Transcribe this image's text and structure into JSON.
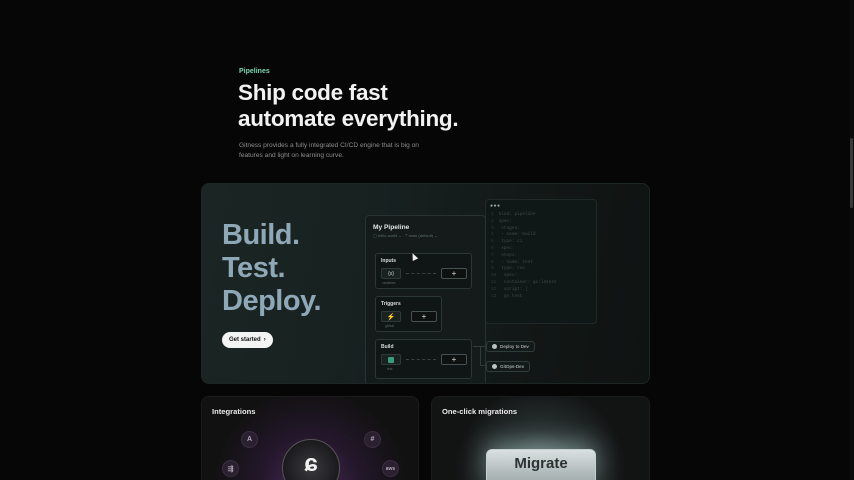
{
  "section": {
    "eyebrow": "Pipelines",
    "headline_line1": "Ship code fast",
    "headline_line2": "automate everything.",
    "subtitle": "Gitness provides a fully integrated CI/CD engine that is big on features and light on learning curve."
  },
  "hero": {
    "words": [
      "Build.",
      "Test.",
      "Deploy."
    ],
    "cta_label": "Get started",
    "cta_icon": "chevron-right-icon",
    "pipeline": {
      "title": "My Pipeline",
      "repo_label": "hello-world",
      "branch_label": "main (default)",
      "stages": [
        {
          "label": "Inputs",
          "node_text": "{x}",
          "node_caption": "variables"
        },
        {
          "label": "Triggers",
          "node_icon": "bolt-icon",
          "node_caption": "github"
        },
        {
          "label": "Build",
          "node_icon": "square-icon",
          "node_caption": "test"
        }
      ],
      "deploy_targets": [
        "Deploy to Dev",
        "GitOps-Dev"
      ]
    },
    "code_lines": [
      {
        "n": "1",
        "t": "kind: pipeline"
      },
      {
        "n": "2",
        "t": "spec:"
      },
      {
        "n": "3",
        "t": "  stages:"
      },
      {
        "n": "4",
        "t": "  - name: build"
      },
      {
        "n": "5",
        "t": "    type: ci"
      },
      {
        "n": "6",
        "t": "    spec:"
      },
      {
        "n": "7",
        "t": "      steps:"
      },
      {
        "n": "8",
        "t": "      - name: test"
      },
      {
        "n": "9",
        "t": "        type: run"
      },
      {
        "n": "10",
        "t": "        spec:"
      },
      {
        "n": "11",
        "t": "          container: go:latest"
      },
      {
        "n": "12",
        "t": "          script: |"
      },
      {
        "n": "13",
        "t": "            go test"
      }
    ]
  },
  "cards": {
    "integrations_title": "Integrations",
    "migrations_title": "One-click migrations",
    "migrate_label": "Migrate",
    "integration_icons": [
      "A",
      "#",
      "⇶",
      "aws"
    ]
  },
  "colors": {
    "accent": "#7fd6b2",
    "hero_text": "#8ea8b8",
    "background": "#060606"
  }
}
